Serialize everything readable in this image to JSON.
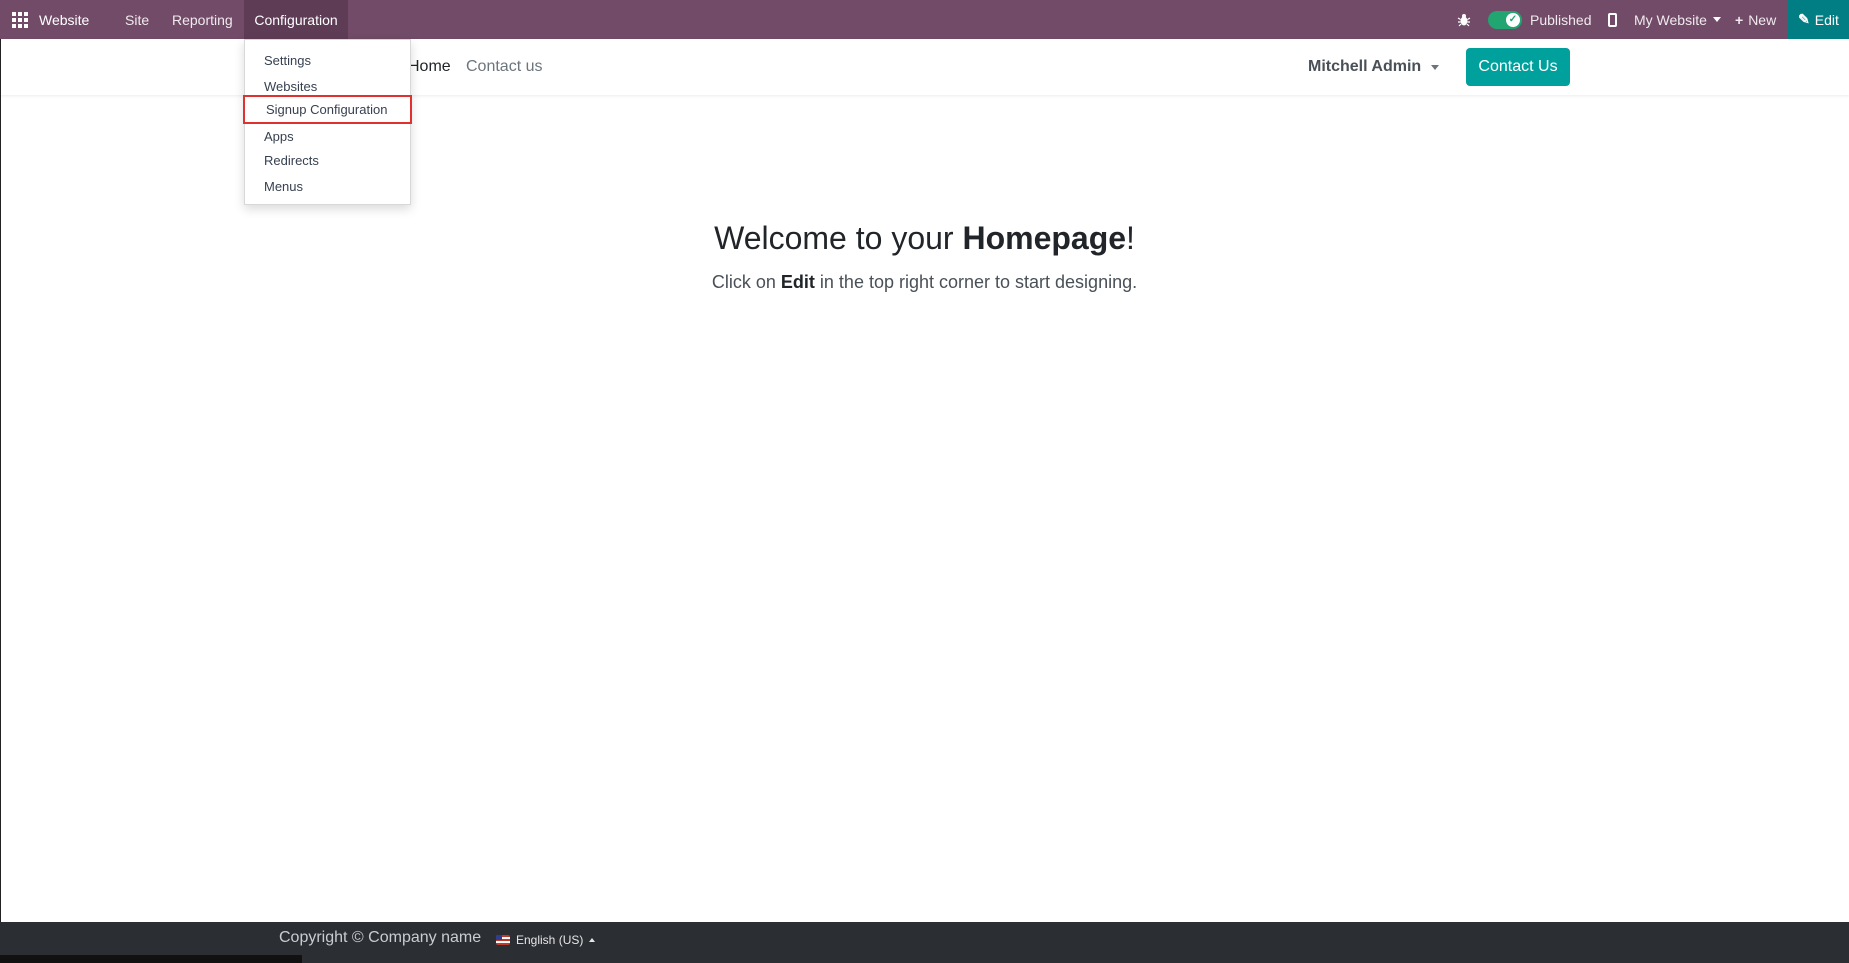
{
  "topbar": {
    "brand": "Website",
    "menus": [
      "Site",
      "Reporting",
      "Configuration"
    ],
    "published_label": "Published",
    "website_selector": "My Website",
    "new_label": "New",
    "edit_label": "Edit",
    "colors": {
      "bar": "#714B67",
      "edit": "#017e84",
      "toggle": "#21a672"
    }
  },
  "configuration_menu": {
    "items": [
      "Settings",
      "Websites",
      "Signup Configuration",
      "Apps",
      "Redirects",
      "Menus"
    ],
    "highlighted": "Signup Configuration"
  },
  "site_header": {
    "nav": [
      "Home",
      "Contact us"
    ],
    "user": "Mitchell Admin",
    "cta": "Contact Us",
    "cta_color": "#00a09d"
  },
  "main": {
    "welcome_prefix": "Welcome to your ",
    "welcome_bold": "Homepage",
    "welcome_suffix": "!",
    "subtitle_prefix": "Click on ",
    "subtitle_bold": "Edit",
    "subtitle_suffix": " in the top right corner to start designing."
  },
  "footer": {
    "copyright": "Copyright © Company name",
    "language": "English (US)"
  }
}
